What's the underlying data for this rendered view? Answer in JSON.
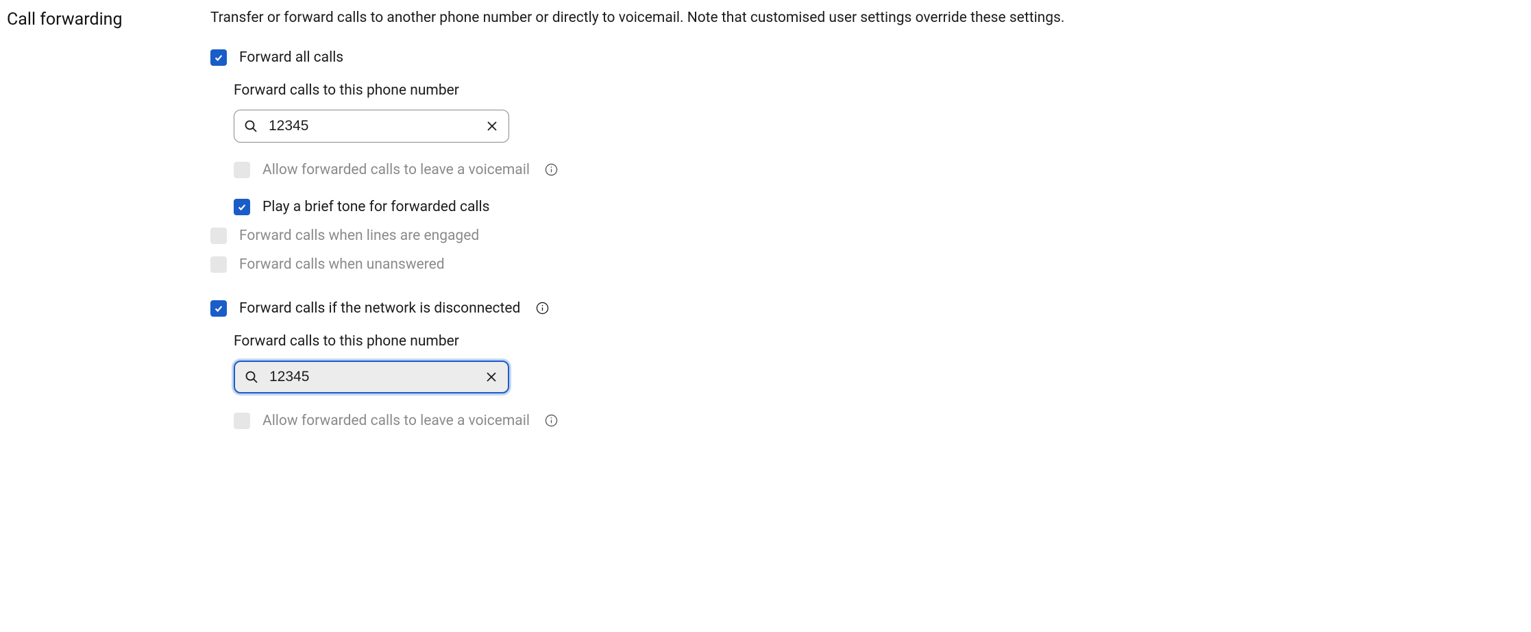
{
  "section": {
    "title": "Call forwarding",
    "description": "Transfer or forward calls to another phone number or directly to voicemail. Note that customised user settings override these settings."
  },
  "forward_all": {
    "label": "Forward all calls",
    "checked": true,
    "phone_label": "Forward calls to this phone number",
    "phone_value": "12345",
    "voicemail_label": "Allow forwarded calls to leave a voicemail",
    "voicemail_checked": false,
    "voicemail_disabled": true,
    "tone_label": "Play a brief tone for forwarded calls",
    "tone_checked": true
  },
  "forward_engaged": {
    "label": "Forward calls when lines are engaged",
    "checked": false,
    "disabled": true
  },
  "forward_unanswered": {
    "label": "Forward calls when unanswered",
    "checked": false,
    "disabled": true
  },
  "forward_disconnected": {
    "label": "Forward calls if the network is disconnected",
    "checked": true,
    "phone_label": "Forward calls to this phone number",
    "phone_value": "12345",
    "voicemail_label": "Allow forwarded calls to leave a voicemail",
    "voicemail_checked": false,
    "voicemail_disabled": true
  }
}
